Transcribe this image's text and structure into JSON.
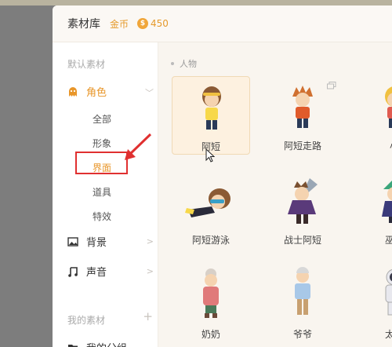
{
  "header": {
    "title": "素材库",
    "coin_label": "金币",
    "coin_symbol": "$",
    "coin_count": "450"
  },
  "sidebar": {
    "default_section": "默认素材",
    "items": [
      {
        "label": "角色",
        "icon": "ghost-icon"
      },
      {
        "label": "背景",
        "icon": "image-icon"
      },
      {
        "label": "声音",
        "icon": "music-note-icon"
      }
    ],
    "sub_items": [
      "全部",
      "形象",
      "界面",
      "道具",
      "特效"
    ],
    "active_sub_item": "界面",
    "my_section": "我的素材",
    "my_group": "我的分组"
  },
  "content": {
    "category": "人物",
    "cards": [
      "阿短",
      "阿短走路",
      "小",
      "阿短游泳",
      "战士阿短",
      "巫师",
      "奶奶",
      "爷爷",
      "太空"
    ]
  },
  "colors": {
    "accent": "#e8962a",
    "annotation": "#e03030"
  }
}
